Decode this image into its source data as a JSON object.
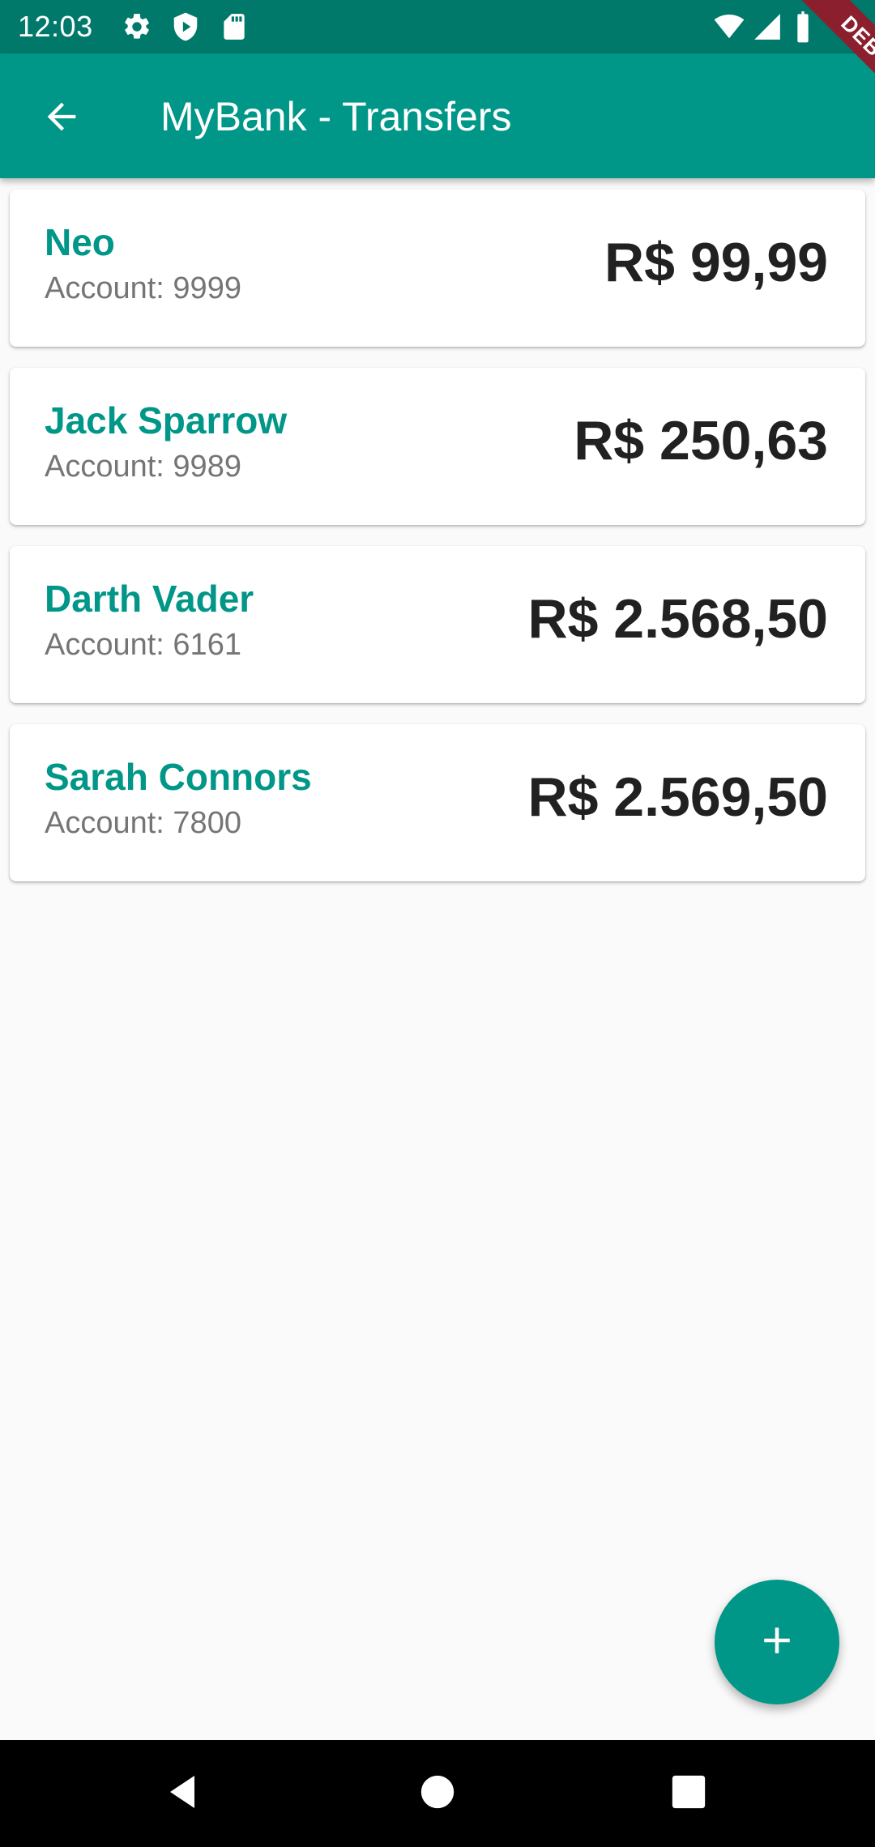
{
  "status_bar": {
    "time": "12:03",
    "left_icons": [
      "settings-icon",
      "shield-icon",
      "sd-card-icon"
    ],
    "right_icons": [
      "wifi-icon",
      "signal-icon",
      "battery-icon"
    ]
  },
  "debug_banner": {
    "label": "DEBUG"
  },
  "app_bar": {
    "title": "MyBank - Transfers",
    "back_icon": "arrow-back-icon"
  },
  "transfers": [
    {
      "name": "Neo",
      "account": "Account: 9999",
      "value": "R$ 99,99"
    },
    {
      "name": "Jack Sparrow",
      "account": "Account: 9989",
      "value": "R$ 250,63"
    },
    {
      "name": "Darth Vader",
      "account": "Account: 6161",
      "value": "R$ 2.568,50"
    },
    {
      "name": "Sarah Connors",
      "account": "Account: 7800",
      "value": "R$ 2.569,50"
    }
  ],
  "fab": {
    "icon": "plus-icon"
  },
  "nav_bar": {
    "buttons": [
      "back-triangle-icon",
      "home-circle-icon",
      "recents-square-icon"
    ]
  },
  "colors": {
    "primary": "#009688",
    "primary_dark": "#00796b",
    "name_text": "#009688",
    "value_text": "#212121",
    "account_text": "#757575",
    "background": "#fafafa",
    "debug_ribbon": "#8b1f2e"
  }
}
